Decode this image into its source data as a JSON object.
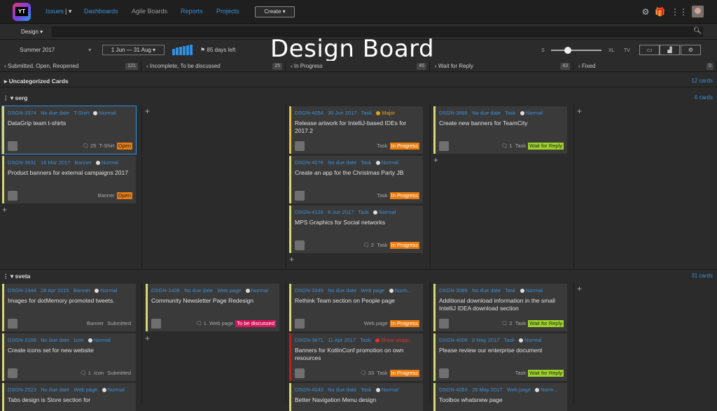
{
  "nav": {
    "logo": "YT",
    "issues": "Issues",
    "dashboards": "Dashboards",
    "agile": "Agile Boards",
    "reports": "Reports",
    "projects": "Projects",
    "create": "Create ▾"
  },
  "search": {
    "board": "Design ▾",
    "placeholder": ""
  },
  "toolbar": {
    "sprint": "Summer 2017",
    "dates": "1 Jun — 31 Aug ▾",
    "days_left": "85 days left",
    "board_title": "Design Board",
    "size_s": "S",
    "size_xl": "XL",
    "tv": "TV"
  },
  "columns": [
    {
      "label": "Submitted, Open, Reopened",
      "count": "121"
    },
    {
      "label": "Incomplete, To be discussed",
      "count": "25"
    },
    {
      "label": "In Progress",
      "count": "45"
    },
    {
      "label": "Wait for Reply",
      "count": "43"
    },
    {
      "label": "Fixed",
      "count": "0"
    }
  ],
  "sections": {
    "uncat": {
      "label": "Uncategorized Cards",
      "count": "12 cards"
    },
    "serg": {
      "label": "serg",
      "count": "6 cards"
    },
    "sveta": {
      "label": "sveta",
      "count": "31 cards"
    }
  },
  "cards": [
    {
      "id": "DSGN-3374",
      "date": "No due date",
      "type": "T-Shirt",
      "prio": "Normal",
      "title": "DataGrip team t-shirts",
      "comments": "25",
      "ftype": "T-Shirt",
      "state": "Open"
    },
    {
      "id": "DSGN-3631",
      "date": "16 Mar 2017",
      "type": "Banner",
      "prio": "Normal",
      "title": "Product banners for external campaigns 2017",
      "comments": "",
      "ftype": "Banner",
      "state": "Open"
    },
    {
      "id": "DSGN-4054",
      "date": "30 Jun 2017",
      "type": "Task",
      "prio": "Major",
      "title": "Release artwork for IntelliJ-based IDEs for 2017.2",
      "comments": "",
      "ftype": "Task",
      "state": "In Progress"
    },
    {
      "id": "DSGN-4076",
      "date": "No due date",
      "type": "Task",
      "prio": "Normal",
      "title": "Create an app for the Christmas Party JB",
      "comments": "",
      "ftype": "Task",
      "state": "In Progress"
    },
    {
      "id": "DSGN-4128",
      "date": "8 Jun 2017",
      "type": "Task",
      "prio": "Normal",
      "title": "MPS Graphics for Social networks",
      "comments": "2",
      "ftype": "Task",
      "state": "In Progress"
    },
    {
      "id": "DSGN-3985",
      "date": "No due date",
      "type": "Task",
      "prio": "Normal",
      "title": "Create new banners for TeamCity",
      "comments": "1",
      "ftype": "Task",
      "state": "Wait for Reply"
    },
    {
      "id": "DSGN-1944",
      "date": "28 Apr 2015",
      "type": "Banner",
      "prio": "Normal",
      "title": "Images for dotMemory promoted tweets.",
      "comments": "",
      "ftype": "Banner",
      "state": "Submitted"
    },
    {
      "id": "DSGN-2108",
      "date": "No due date",
      "type": "Icon",
      "prio": "Normal",
      "title": "Create icons set for new website",
      "comments": "1",
      "ftype": "Icon",
      "state": "Submitted"
    },
    {
      "id": "DSGN-2523",
      "date": "No due date",
      "type": "Web page",
      "prio": "Normal",
      "title": "Tabs design is Store section for",
      "comments": "",
      "ftype": "",
      "state": ""
    },
    {
      "id": "DSGN-1438",
      "date": "No due date",
      "type": "Web page",
      "prio": "Normal",
      "title": "Community Newsletter Page Redesign",
      "comments": "1",
      "ftype": "Web page",
      "state": "To be discussed"
    },
    {
      "id": "DSGN-3345",
      "date": "No due date",
      "type": "Web page",
      "prio": "Norm...",
      "title": "Rethink Team section on People page",
      "comments": "",
      "ftype": "Web page",
      "state": "In Progress"
    },
    {
      "id": "DSGN-3871",
      "date": "11 Apr 2017",
      "type": "Task",
      "prio": "Show-stopp...",
      "title": "Banners for KotlinConf promotion on own resources",
      "comments": "33",
      "ftype": "Task",
      "state": "In Progress"
    },
    {
      "id": "DSGN-4043",
      "date": "No due date",
      "type": "Task",
      "prio": "Normal",
      "title": "Better Navigation Menu design",
      "comments": "",
      "ftype": "",
      "state": ""
    },
    {
      "id": "DSGN-3089",
      "date": "No due date",
      "type": "Task",
      "prio": "Normal",
      "title": "Additional download information in the small IntelliJ IDEA download section",
      "comments": "2",
      "ftype": "Task",
      "state": "Wait for Reply"
    },
    {
      "id": "DSGN-4009",
      "date": "8 May 2017",
      "type": "Task",
      "prio": "Normal",
      "title": "Please review our enterprise document",
      "comments": "",
      "ftype": "Task",
      "state": "Wait for Reply"
    },
    {
      "id": "DSGN-4053",
      "date": "26 May 2017",
      "type": "Web page",
      "prio": "Norm...",
      "title": "Toolbox whatsnew page",
      "comments": "",
      "ftype": "",
      "state": ""
    }
  ],
  "colors": {
    "accent": "#3b8fd6",
    "progress": "#e97c10",
    "wait": "#9fd22a",
    "discuss": "#d4145a"
  }
}
